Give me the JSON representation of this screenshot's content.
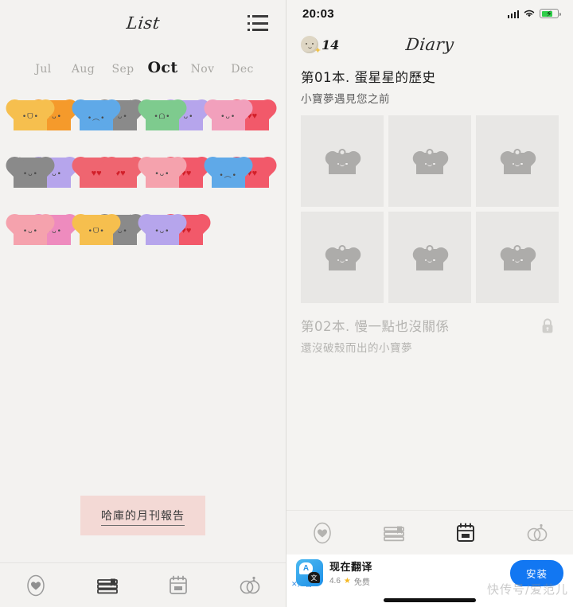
{
  "left": {
    "title": "List",
    "list_icon": "list-icon",
    "months": [
      {
        "label": "Jul",
        "active": false
      },
      {
        "label": "Aug",
        "active": false
      },
      {
        "label": "Sep",
        "active": false
      },
      {
        "label": "Oct",
        "active": true
      },
      {
        "label": "Nov",
        "active": false
      },
      {
        "label": "Dec",
        "active": false
      }
    ],
    "pairs": [
      {
        "left_color": "#f6bf4e",
        "right_color": "#f59a2b",
        "left_face": "•ᗜ•",
        "right_face": "•ᴗ•",
        "ears": "none",
        "hearts": false
      },
      {
        "left_color": "#5fa9e8",
        "right_color": "#8a8a8a",
        "left_face": "•︵•",
        "right_face": "•ᴗ•",
        "ears": "right",
        "hearts": false
      },
      {
        "left_color": "#7ecb8e",
        "right_color": "#b6a5ec",
        "left_face": "•ᗝ•",
        "right_face": "•ᴗ•",
        "ears": "none",
        "hearts": false
      },
      {
        "left_color": "#f2a0bc",
        "right_color": "#f2596a",
        "left_face": "•ᴗ•",
        "right_face": "",
        "ears": "none",
        "hearts": true
      },
      {
        "left_color": "#8a8a8a",
        "right_color": "#b6a5ec",
        "left_face": "•ᴗ•",
        "right_face": "•ᴗ•",
        "ears": "left",
        "hearts": false
      },
      {
        "left_color": "#ef6570",
        "right_color": "#ef6570",
        "left_face": "",
        "right_face": "",
        "ears": "none",
        "hearts": true
      },
      {
        "left_color": "#f5a2ad",
        "right_color": "#f2596a",
        "left_face": "•ᴗ•",
        "right_face": "",
        "ears": "none",
        "hearts": true
      },
      {
        "left_color": "#5fa9e8",
        "right_color": "#f2596a",
        "left_face": "•︵•",
        "right_face": "",
        "ears": "none",
        "hearts": true
      },
      {
        "left_color": "#f5a2ad",
        "right_color": "#ee8bbe",
        "left_face": "•ᴗ•",
        "right_face": "•ᴗ•",
        "ears": "none",
        "hearts": false
      },
      {
        "left_color": "#f6bf4e",
        "right_color": "#8a8a8a",
        "left_face": "•ᗜ•",
        "right_face": "•ᴗ•",
        "ears": "right",
        "hearts": false
      },
      {
        "left_color": "#b6a5ec",
        "right_color": "#f2596a",
        "left_face": "•ᴗ•",
        "right_face": "",
        "ears": "none",
        "hearts": true
      }
    ],
    "report_button": "哈庫的月刊報告",
    "nav": [
      {
        "name": "heart-egg-icon",
        "label": "heart",
        "active": false
      },
      {
        "name": "books-icon",
        "label": "books",
        "active": true
      },
      {
        "name": "calendar-icon",
        "label": "calendar",
        "active": false
      },
      {
        "name": "rings-icon",
        "label": "rings",
        "active": false
      }
    ]
  },
  "right": {
    "statusbar": {
      "time": "20:03",
      "signal": "cellular-icon",
      "wifi": "wifi-icon",
      "battery": "battery-charging-icon"
    },
    "header": {
      "title": "Diary",
      "egg_icon": "egg-avatar-icon",
      "star_icon": "star-icon",
      "count": "14"
    },
    "book1": {
      "title": "第01本. 蛋星星的歷史",
      "subtitle": "小寶夢遇見您之前",
      "cells": [
        {
          "icon": "heart-charm-icon"
        },
        {
          "icon": "heart-charm-icon"
        },
        {
          "icon": "heart-charm-icon"
        },
        {
          "icon": "heart-charm-icon"
        },
        {
          "icon": "heart-charm-icon"
        },
        {
          "icon": "heart-charm-icon"
        }
      ]
    },
    "book2": {
      "title": "第02本. 慢一點也沒關係",
      "subtitle": "還沒破殼而出的小寶夢",
      "lock_icon": "lock-icon"
    },
    "nav": [
      {
        "name": "heart-egg-icon",
        "label": "heart",
        "active": false
      },
      {
        "name": "books-icon",
        "label": "books",
        "active": false
      },
      {
        "name": "calendar-icon",
        "label": "calendar",
        "active": true
      },
      {
        "name": "rings-icon",
        "label": "rings",
        "active": false
      }
    ],
    "ad": {
      "close_label": "广告",
      "icon": "translate-app-icon",
      "icon_letter_a": "A",
      "icon_letter_cn": "文",
      "title": "现在翻译",
      "rating": "4.6",
      "star": "★",
      "price": "免费",
      "install_label": "安装"
    },
    "watermark": "快传号/爱范儿"
  },
  "colors": {
    "accent_blue": "#1277f2",
    "report_pink": "#f3d9d5",
    "battery_green": "#2fce4a",
    "placeholder_gray": "#e8e7e5"
  }
}
